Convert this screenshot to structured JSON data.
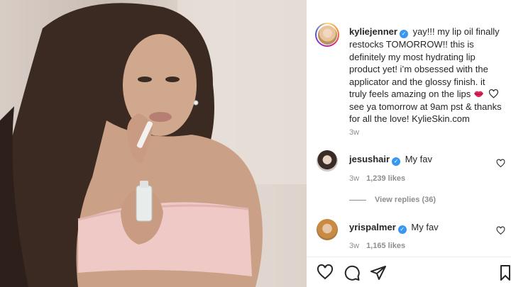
{
  "post": {
    "author": "kyliejenner",
    "caption": "yay!!! my lip oil finally restocks TOMORROW!! this is definitely my most hydrating lip product yet! i’m obsessed with the applicator and the glossy finish. it truly feels amazing on the lips",
    "caption_tail": "see ya tomorrow at 9am pst & thanks for all the love! KylieSkin.com",
    "time": "3w"
  },
  "comments": [
    {
      "user": "jesushair",
      "text": "My fav",
      "time": "3w",
      "likes": "1,239 likes",
      "view_replies": "View replies (36)"
    },
    {
      "user": "yrispalmer",
      "text": "My fav",
      "time": "3w",
      "likes": "1,165 likes"
    }
  ],
  "icons": {
    "verified": "verified-badge-icon",
    "lips": "lips-emoji-icon",
    "heart": "heart-icon",
    "comment": "comment-icon",
    "share": "share-icon",
    "save": "bookmark-icon"
  },
  "colors": {
    "verified": "#3897f0",
    "text": "#262626",
    "muted": "#8e8e8e",
    "lips": "#e0245e"
  }
}
